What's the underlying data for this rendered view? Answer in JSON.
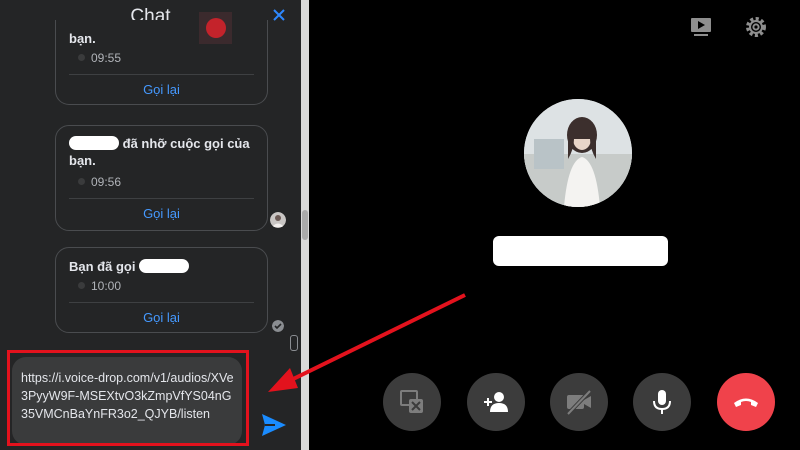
{
  "chat": {
    "title": "Chat",
    "messages": [
      {
        "text": "bạn.",
        "time": "09:55",
        "action": "Gọi lại"
      },
      {
        "text": "đã nhỡ cuộc gọi của bạn.",
        "time": "09:56",
        "action": "Gọi lại"
      },
      {
        "text": "Bạn đã gọi",
        "time": "10:00",
        "action": "Gọi lại"
      }
    ],
    "compose_text": "https://i.voice-drop.com/v1/audios/XVe3PyyW9F-MSEXtvO3kZmpVfYS04nG35VMCnBaYnFR3o2_QJYB/listen"
  },
  "call": {
    "controls": [
      "stop-screen-share-icon",
      "add-person-icon",
      "video-off-icon",
      "microphone-icon",
      "end-call-icon"
    ],
    "end_call_color": "#f0424b"
  },
  "colors": {
    "highlight": "#e3121d",
    "link": "#4599ff",
    "send": "#1a8cff"
  }
}
